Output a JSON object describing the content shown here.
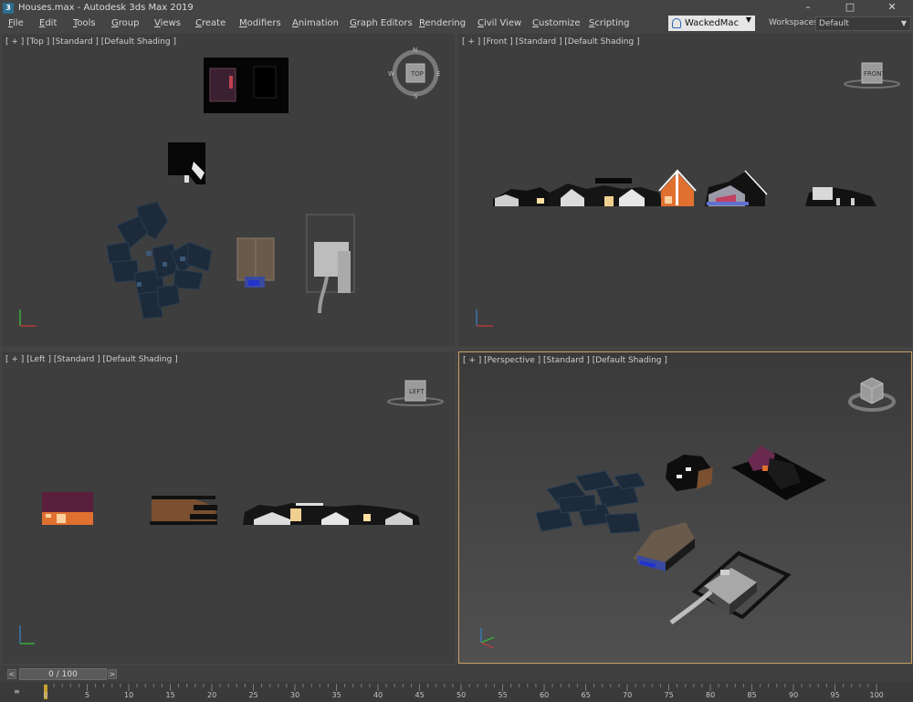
{
  "window": {
    "title": "Houses.max - Autodesk 3ds Max 2019",
    "icon_label": "3",
    "minimize": "–",
    "maximize": "□",
    "close": "✕"
  },
  "menu": {
    "items": [
      "File",
      "Edit",
      "Tools",
      "Group",
      "Views",
      "Create",
      "Modifiers",
      "Animation",
      "Graph Editors",
      "Rendering",
      "Civil View",
      "Customize",
      "Scripting"
    ]
  },
  "user": {
    "name": "WackedMac"
  },
  "workspaces": {
    "label": "Workspaces:",
    "value": "Default"
  },
  "viewports": {
    "top": {
      "label": "[ + ] [Top ] [Standard ] [Default Shading ]",
      "cube_face": "TOP"
    },
    "front": {
      "label": "[ + ] [Front ] [Standard ] [Default Shading ]",
      "cube_face": "FRONT"
    },
    "left": {
      "label": "[ + ] [Left ] [Standard ] [Default Shading ]",
      "cube_face": "LEFT"
    },
    "perspective": {
      "label": "[ + ] [Perspective ] [Standard ] [Default Shading ]"
    }
  },
  "compass": {
    "n": "N",
    "s": "S",
    "e": "E",
    "w": "W"
  },
  "timeslider": {
    "value": "0 / 100",
    "prev": "<",
    "next": ">"
  },
  "trackbar": {
    "ticks": [
      "0",
      "5",
      "10",
      "15",
      "20",
      "25",
      "30",
      "35",
      "40",
      "45",
      "50",
      "55",
      "60",
      "65",
      "70",
      "75",
      "80",
      "85",
      "90",
      "95",
      "100"
    ]
  },
  "colors": {
    "viewport_bg": "#3e3e3e",
    "active_border": "#c8a060",
    "house_dark": "#1e2a38",
    "roof_maroon": "#5a1f3c",
    "wall_orange": "#e07030",
    "wall_brown": "#7a5030"
  }
}
